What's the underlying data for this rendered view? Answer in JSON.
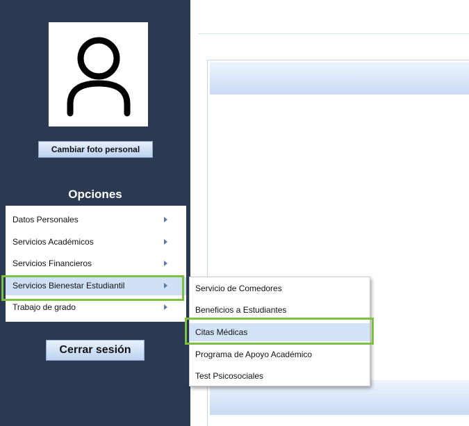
{
  "sidebar": {
    "change_photo_label": "Cambiar foto personal",
    "options_title": "Opciones",
    "menu": [
      {
        "label": "Datos Personales"
      },
      {
        "label": "Servicios Académicos"
      },
      {
        "label": "Servicios Financieros"
      },
      {
        "label": "Servicios Bienestar Estudiantil"
      },
      {
        "label": "Trabajo de grado"
      }
    ],
    "logout_label": "Cerrar sesión"
  },
  "submenu": [
    {
      "label": "Servicio de Comedores"
    },
    {
      "label": "Beneficios a Estudiantes"
    },
    {
      "label": "Citas Médicas"
    },
    {
      "label": "Programa de Apoyo Académico"
    },
    {
      "label": "Test Psicosociales"
    }
  ],
  "colors": {
    "sidebar_bg": "#2b3a52",
    "highlight": "#7dc142",
    "hover_bg": "#cfe0f5"
  },
  "icons": {
    "avatar": "user-silhouette-icon",
    "arrow": "chevron-right-icon"
  }
}
